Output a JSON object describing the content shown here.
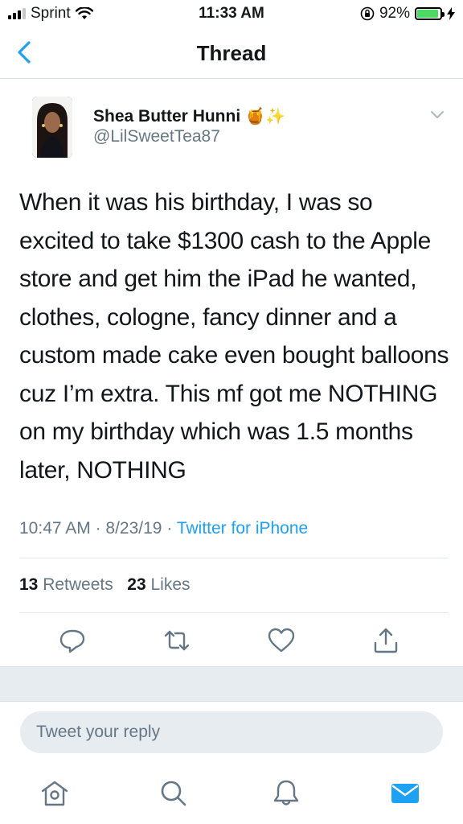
{
  "status_bar": {
    "carrier": "Sprint",
    "time": "11:33 AM",
    "battery_percent": "92%",
    "battery_level": 0.92
  },
  "nav": {
    "title": "Thread",
    "back_icon": "chevron-left-icon"
  },
  "tweet": {
    "author_name": "Shea Butter Hunni",
    "author_emoji": "🍯✨",
    "handle": "@LilSweetTea87",
    "text": "When it was his birthday, I was so excited to take $1300 cash to the Apple store and get him the iPad he wanted, clothes, cologne, fancy dinner and a custom made cake even bought balloons cuz I’m extra. This mf got me NOTHING on my birthday which was 1.5 months later, NOTHING",
    "time": "10:47 AM",
    "date": "8/23/19",
    "separator": "·",
    "source": "Twitter for iPhone",
    "retweets_count": "13",
    "retweets_label": "Retweets",
    "likes_count": "23",
    "likes_label": "Likes"
  },
  "reply": {
    "placeholder": "Tweet your reply"
  },
  "colors": {
    "accent": "#1da1f2",
    "secondary_text": "#657786",
    "divider": "#e1e8ed"
  }
}
